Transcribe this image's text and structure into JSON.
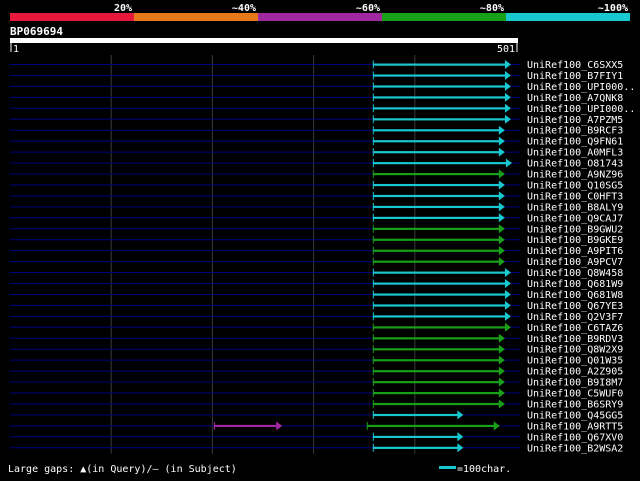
{
  "colors": {
    "background": "#000000",
    "text": "#ffffff",
    "ruler": "#ffffff",
    "background_track": "#000080",
    "gridline": "#3c3c3c",
    "legend_bar": "#18c8d0"
  },
  "identity_legend": {
    "segments": [
      {
        "label": "20%",
        "color": "#e8183c"
      },
      {
        "label": "~40%",
        "color": "#e8781c"
      },
      {
        "label": "~60%",
        "color": "#a028a0"
      },
      {
        "label": "~80%",
        "color": "#18a018"
      },
      {
        "label": "~100%",
        "color": "#18c8d0"
      }
    ]
  },
  "query": {
    "name": "BP069694",
    "length_label_start": "1",
    "length_label_end": "501"
  },
  "footer": {
    "gaps_note": "Large gaps: ▲(in Query)/— (in Subject)",
    "scale_note": "=100char."
  },
  "chart_data": {
    "type": "alignment-overview",
    "query_length": 501,
    "grid_positions": [
      100,
      200,
      300,
      400
    ],
    "hits": [
      {
        "name": "UniRef100_C6SXX5",
        "start": 359,
        "end": 495,
        "identity": "~100%"
      },
      {
        "name": "UniRef100_B7FIY1",
        "start": 359,
        "end": 495,
        "identity": "~100%"
      },
      {
        "name": "UniRef100_UPI000..",
        "start": 359,
        "end": 495,
        "identity": "~100%"
      },
      {
        "name": "UniRef100_A7QNK8",
        "start": 359,
        "end": 495,
        "identity": "~100%"
      },
      {
        "name": "UniRef100_UPI000..",
        "start": 359,
        "end": 495,
        "identity": "~100%"
      },
      {
        "name": "UniRef100_A7PZM5",
        "start": 359,
        "end": 495,
        "identity": "~100%"
      },
      {
        "name": "UniRef100_B9RCF3",
        "start": 359,
        "end": 489,
        "identity": "~100%"
      },
      {
        "name": "UniRef100_Q9FN61",
        "start": 359,
        "end": 489,
        "identity": "~100%"
      },
      {
        "name": "UniRef100_A0MFL3",
        "start": 359,
        "end": 489,
        "identity": "~100%"
      },
      {
        "name": "UniRef100_O81743",
        "start": 359,
        "end": 496,
        "identity": "~100%"
      },
      {
        "name": "UniRef100_A9NZ96",
        "start": 359,
        "end": 489,
        "identity": "~80%"
      },
      {
        "name": "UniRef100_Q10SG5",
        "start": 359,
        "end": 489,
        "identity": "~100%"
      },
      {
        "name": "UniRef100_C0HFT3",
        "start": 359,
        "end": 489,
        "identity": "~100%"
      },
      {
        "name": "UniRef100_B8ALY9",
        "start": 359,
        "end": 489,
        "identity": "~100%"
      },
      {
        "name": "UniRef100_Q9CAJ7",
        "start": 359,
        "end": 489,
        "identity": "~100%"
      },
      {
        "name": "UniRef100_B9GWU2",
        "start": 359,
        "end": 489,
        "identity": "~80%"
      },
      {
        "name": "UniRef100_B9GKE9",
        "start": 359,
        "end": 489,
        "identity": "~80%"
      },
      {
        "name": "UniRef100_A9PIT6",
        "start": 359,
        "end": 489,
        "identity": "~80%"
      },
      {
        "name": "UniRef100_A9PCV7",
        "start": 359,
        "end": 489,
        "identity": "~80%"
      },
      {
        "name": "UniRef100_Q8W458",
        "start": 359,
        "end": 495,
        "identity": "~100%"
      },
      {
        "name": "UniRef100_Q681W9",
        "start": 359,
        "end": 495,
        "identity": "~100%"
      },
      {
        "name": "UniRef100_Q681W8",
        "start": 359,
        "end": 495,
        "identity": "~100%"
      },
      {
        "name": "UniRef100_Q67YE3",
        "start": 359,
        "end": 495,
        "identity": "~100%"
      },
      {
        "name": "UniRef100_Q2V3F7",
        "start": 359,
        "end": 495,
        "identity": "~100%"
      },
      {
        "name": "UniRef100_C6TAZ6",
        "start": 359,
        "end": 495,
        "identity": "~80%"
      },
      {
        "name": "UniRef100_B9RDV3",
        "start": 359,
        "end": 489,
        "identity": "~80%"
      },
      {
        "name": "UniRef100_Q8W2X9",
        "start": 359,
        "end": 489,
        "identity": "~80%"
      },
      {
        "name": "UniRef100_Q01W35",
        "start": 359,
        "end": 489,
        "identity": "~80%"
      },
      {
        "name": "UniRef100_A2Z905",
        "start": 359,
        "end": 489,
        "identity": "~80%"
      },
      {
        "name": "UniRef100_B9I8M7",
        "start": 359,
        "end": 489,
        "identity": "~80%"
      },
      {
        "name": "UniRef100_C5WUF0",
        "start": 359,
        "end": 489,
        "identity": "~80%"
      },
      {
        "name": "UniRef100_B6SRY9",
        "start": 359,
        "end": 489,
        "identity": "~80%"
      },
      {
        "name": "UniRef100_Q45GG5",
        "start": 359,
        "end": 448,
        "identity": "~100%"
      },
      {
        "name": "UniRef100_A9RTT5",
        "start": 202,
        "end": 484,
        "identity": "~80%",
        "segments": [
          {
            "start": 202,
            "end": 269,
            "identity": "~60%"
          },
          {
            "start": 353,
            "end": 484,
            "identity": "~80%"
          }
        ]
      },
      {
        "name": "UniRef100_Q67XV0",
        "start": 359,
        "end": 448,
        "identity": "~100%"
      },
      {
        "name": "UniRef100_B2WSA2",
        "start": 359,
        "end": 448,
        "identity": "~100%"
      }
    ]
  }
}
